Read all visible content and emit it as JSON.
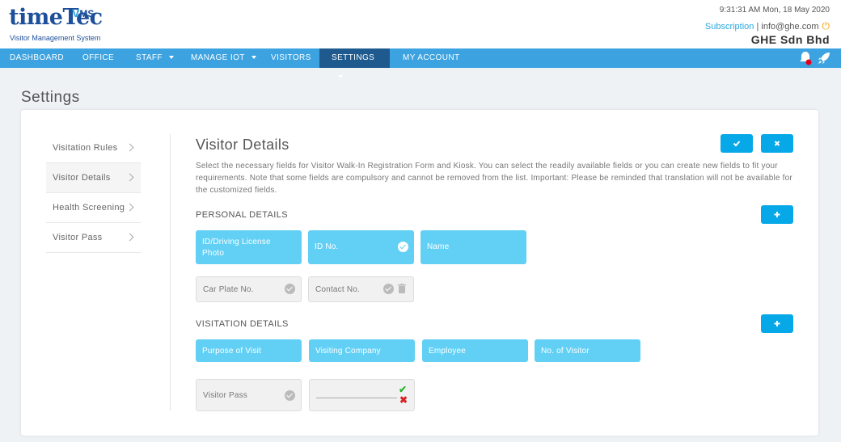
{
  "header": {
    "logo_main": "timeTec",
    "logo_vms": "MS",
    "logo_v": "V",
    "logo_sub": "Visitor Management System",
    "time": "9:31:31 AM  Mon, 18 May 2020",
    "subscription": "Subscription",
    "separator": " | ",
    "email": "info@ghe.com",
    "company": "GHE Sdn Bhd"
  },
  "nav": {
    "dashboard": "DASHBOARD",
    "office": "OFFICE",
    "staff": "STAFF",
    "manage_iot": "MANAGE IOT",
    "visitors": "VISITORS",
    "settings": "SETTINGS",
    "my_account": "MY ACCOUNT"
  },
  "page": {
    "title": "Settings"
  },
  "sidebar": {
    "items": [
      {
        "label": "Visitation Rules"
      },
      {
        "label": "Visitor Details"
      },
      {
        "label": "Health Screening"
      },
      {
        "label": "Visitor Pass"
      }
    ]
  },
  "main": {
    "title": "Visitor Details",
    "description": "Select the necessary fields for Visitor Walk-In Registration Form and Kiosk. You can select the readily available fields or you can create new fields to fit your requirements. Note that some fields are compulsory and cannot be removed from the list. Important: Please be reminded that translation will not be available for the customized fields.",
    "personal_title": "PERSONAL DETAILS",
    "visitation_title": "VISITATION DETAILS",
    "personal_fields": [
      {
        "label": "ID/Driving License Photo"
      },
      {
        "label": "ID No."
      },
      {
        "label": "Name"
      },
      {
        "label": "Car Plate No."
      },
      {
        "label": "Contact No."
      }
    ],
    "visitation_fields": [
      {
        "label": "Purpose of Visit"
      },
      {
        "label": "Visiting Company"
      },
      {
        "label": "Employee"
      },
      {
        "label": "No. of Visitor"
      },
      {
        "label": "Visitor Pass"
      }
    ]
  },
  "colors": {
    "nav_bg": "#3ca3e0",
    "nav_active": "#1f5a8e",
    "field_selected": "#62d0f5",
    "button": "#06a8e8"
  },
  "icons": {
    "save": "check-icon",
    "cancel": "close-icon",
    "add": "plus-icon"
  }
}
